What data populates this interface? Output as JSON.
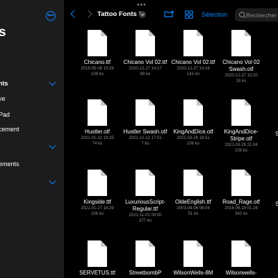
{
  "sidebar": {
    "title": "s",
    "sections": [
      {
        "label": "nts"
      },
      {
        "label": ""
      }
    ],
    "items": [
      {
        "label": "ve"
      },
      {
        "label": "Pad"
      },
      {
        "label": "cement"
      },
      {
        "label": "ements"
      }
    ]
  },
  "header": {
    "top_dots": "•••",
    "folder_title": "Tattoo Fonts 3",
    "select_label": "Sélection",
    "search_placeholder": "Rechercher"
  },
  "files": [
    {
      "name": "Chicano.ttf",
      "date": "2019-05-08 15:29",
      "size": "109 ko"
    },
    {
      "name": "Chicano Vol 02.ttf",
      "date": "2020-12-27 14:17",
      "size": "89 ko"
    },
    {
      "name": "Chicano Vol 02.ttf",
      "date": "2020-12-27 14:16",
      "size": "141 ko"
    },
    {
      "name": "Chicano Vol 02 Swash.otf",
      "date": "2020-12-27 13:20",
      "size": "15 ko"
    },
    {
      "name": "Hustler.otf",
      "date": "2022-01-12 19:25",
      "size": "74 ko"
    },
    {
      "name": "Hustler Swash.otf",
      "date": "2021-12-12 17:01",
      "size": "7 ko"
    },
    {
      "name": "KingAndDice.otf",
      "date": "2021-03-29 18:51",
      "size": "106 ko"
    },
    {
      "name": "KingAndDice-Stripe.otf",
      "date": "2021-03-29 21:04",
      "size": "109 ko"
    },
    {
      "name": "Kingside.ttf",
      "date": "2022-01-27 16:29",
      "size": "106 ko"
    },
    {
      "name": "LuxuriousScript-Regular.ttf",
      "date": "2021-11-02 00:00",
      "size": "377 ko"
    },
    {
      "name": "OldeEnglish.ttf",
      "date": "2003-09-06 08:04",
      "size": "51 ko"
    },
    {
      "name": "Road_Rage.otf",
      "date": "2016-06-19 01:26",
      "size": "342 ko"
    },
    {
      "name": "SERVETUS.ttf",
      "date": "",
      "size": ""
    },
    {
      "name": "StreetbombP",
      "date": "",
      "size": ""
    },
    {
      "name": "WilsonWells-8M",
      "date": "",
      "size": ""
    },
    {
      "name": "Wilsonwells-",
      "date": "",
      "size": ""
    }
  ],
  "partial_column": [
    {
      "name": "St"
    },
    {
      "name": "SE"
    }
  ],
  "colors": {
    "accent": "#0a84ff",
    "background": "#000000",
    "sidebar": "#1c1c1e"
  }
}
